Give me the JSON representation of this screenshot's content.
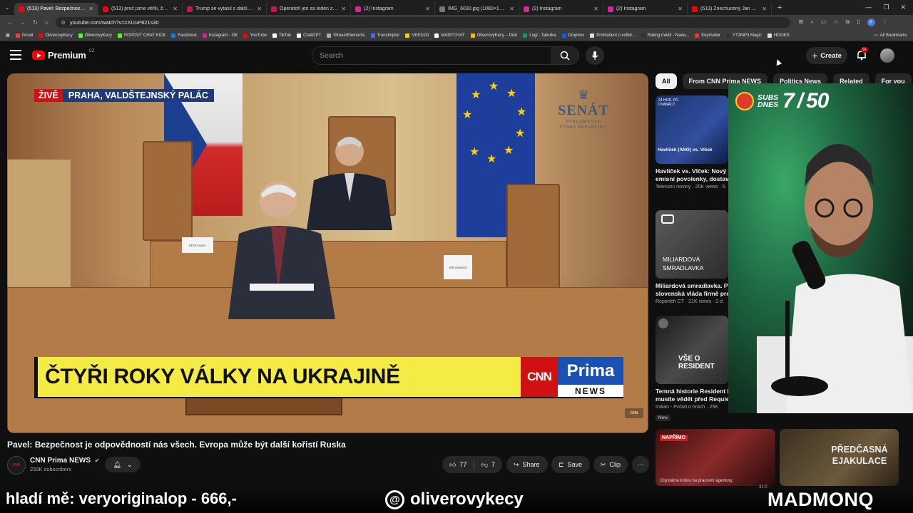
{
  "browser": {
    "tabs": [
      {
        "label": "(513) Pavel: Bezpečnost je odp",
        "color": "#ff0000",
        "active": true
      },
      {
        "label": "(513) proč jsme věřili, že v roce",
        "color": "#ff0000"
      },
      {
        "label": "Trump se vytasil s dalším termí",
        "color": "#c2185b"
      },
      {
        "label": "Operátoři jen za leden zablok",
        "color": "#c2185b"
      },
      {
        "label": "(2) Instagram",
        "color": "#d6249f"
      },
      {
        "label": "IMG_6030.jpg (1080×1620)",
        "color": "#777777"
      },
      {
        "label": "(2) Instagram",
        "color": "#d6249f"
      },
      {
        "label": "(2) Instagram",
        "color": "#d6249f"
      },
      {
        "label": "(513) Znechucený Jan Rosák zl",
        "color": "#ff0000"
      }
    ],
    "url": "youtube.com/watch?v=cXUuP821s30",
    "bookmarks": [
      {
        "label": "Gmail",
        "color": "#ea4335"
      },
      {
        "label": "OliverovyKecy",
        "color": "#ff0000"
      },
      {
        "label": "OliverovyKecy",
        "color": "#53fc18"
      },
      {
        "label": "POPOUT CHAT KICK",
        "color": "#53fc18"
      },
      {
        "label": "Facebook",
        "color": "#1877f2"
      },
      {
        "label": "Instagram - OK",
        "color": "#d6249f"
      },
      {
        "label": "YouTube",
        "color": "#ff0000"
      },
      {
        "label": "TikTok",
        "color": "#ffffff"
      },
      {
        "label": "ChatGPT",
        "color": "#ffffff"
      },
      {
        "label": "StreamElements",
        "color": "#aaaaaa"
      },
      {
        "label": "Transkriptor",
        "color": "#4a66ff"
      },
      {
        "label": "VEEDJO",
        "color": "#ffcc00"
      },
      {
        "label": "MANYCHAT",
        "color": "#ffffff"
      },
      {
        "label": "OliverovyKecy – Disk",
        "color": "#fbbc04"
      },
      {
        "label": "Logi - Tabulka",
        "color": "#0f9d58"
      },
      {
        "label": "Dropbox",
        "color": "#0061ff"
      },
      {
        "label": "Prohlášení o volbě...",
        "color": "#dddddd"
      },
      {
        "label": "Rating médií - Nada...",
        "color": "#333333"
      },
      {
        "label": "Keymailer",
        "color": "#e53935"
      },
      {
        "label": "YT2MP3 Magic",
        "color": "#333333"
      },
      {
        "label": "HOOKS",
        "color": "#dddddd"
      }
    ],
    "all_bookmarks": "All Bookmarks"
  },
  "youtube": {
    "logo_word": "Premium",
    "logo_country": "CZ",
    "search_placeholder": "Search",
    "create_label": "Create",
    "notif_badge": "9+"
  },
  "video": {
    "live_label": "ŽIVĚ",
    "location": "PRAHA, VALDŠTEJNSKÝ PALÁC",
    "senat": "SENÁT",
    "senat_sub1": "PARLAMENTU",
    "senat_sub2": "ČESKÉ REPUBLIKY",
    "lower_third": "ČTYŘI ROKY VÁLKY NA UKRAJINĚ",
    "cnn": "CNN",
    "prima": "Prima",
    "news": "NEWS",
    "placard1": "PETR PAVEL",
    "placard2": "JIŘÍ DRAHOŠ",
    "title": "Pavel: Bezpečnost je odpovědností nás všech. Evropa může být další kořistí Ruska",
    "channel": "CNN Prima NEWS",
    "subscribers": "233K subscribers",
    "likes": "77",
    "dislikes": "7",
    "share": "Share",
    "save": "Save",
    "clip": "Clip"
  },
  "sidebar": {
    "chips": [
      "All",
      "From CNN Prima NEWS",
      "Politics News",
      "Related",
      "For you"
    ],
    "items": [
      {
        "title": "Havlíček vs. Vlček: Nový n",
        "title2": "emisní povolenky, dostavb",
        "meta": "Televizní noviny · 20K views · 5",
        "thumb_text": "Havlíček (ANO) vs. Vlček",
        "thumb_tag": "24 HOD. PO DVANÁCT"
      },
      {
        "title": "Miliardová smradlavka. Po",
        "title2": "slovenská vláda firmě prer",
        "meta": "Reportéři ČT · 21K views · 2 d",
        "thumb_text": "MILIARDOVÁ SMRADLAVKA"
      },
      {
        "title": "Temná historie Resident E",
        "title2": "musíte vědět před Requier",
        "meta": "Indian - Pořad o hrách · 25K",
        "thumb_text": "VŠE O RESIDENT",
        "badge": "New"
      }
    ]
  },
  "bottom_thumbs": [
    {
      "text": "NAPŘÍMO",
      "caption": "Chystáme kobru na pracovní agentury,"
    },
    {
      "text": "PŘEDČASNÁ EJAKULACE"
    }
  ],
  "stream_overlay": {
    "subs_label": "SUBS DNES",
    "subs_current": "7",
    "subs_goal": "50",
    "left_text": "hladí mě: veryoriginalop - 666,-",
    "handle": "oliverovykecy",
    "right_text": "MADMONQ",
    "timer": "31:0"
  }
}
